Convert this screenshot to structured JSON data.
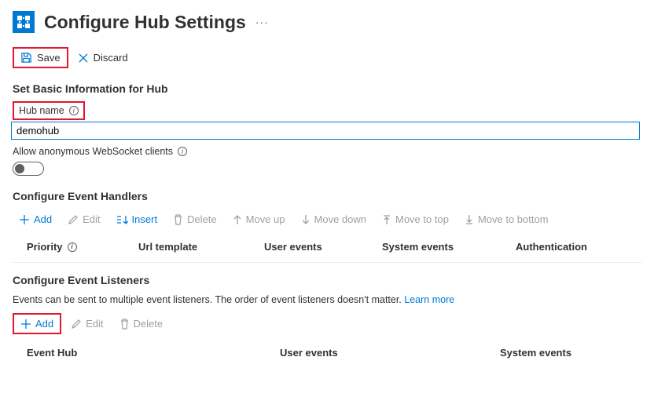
{
  "header": {
    "title": "Configure Hub Settings"
  },
  "toolbar": {
    "save": "Save",
    "discard": "Discard"
  },
  "basic": {
    "section_title": "Set Basic Information for Hub",
    "hub_name_label": "Hub name",
    "hub_name_value": "demohub",
    "allow_anon_label": "Allow anonymous WebSocket clients"
  },
  "handlers": {
    "section_title": "Configure Event Handlers",
    "cmds": {
      "add": "Add",
      "edit": "Edit",
      "insert": "Insert",
      "delete": "Delete",
      "move_up": "Move up",
      "move_down": "Move down",
      "move_top": "Move to top",
      "move_bottom": "Move to bottom"
    },
    "cols": {
      "priority": "Priority",
      "url": "Url template",
      "user_events": "User events",
      "system_events": "System events",
      "auth": "Authentication"
    }
  },
  "listeners": {
    "section_title": "Configure Event Listeners",
    "desc": "Events can be sent to multiple event listeners. The order of event listeners doesn't matter. ",
    "learn_more": "Learn more",
    "cmds": {
      "add": "Add",
      "edit": "Edit",
      "delete": "Delete"
    },
    "cols": {
      "event_hub": "Event Hub",
      "user_events": "User events",
      "system_events": "System events"
    }
  }
}
